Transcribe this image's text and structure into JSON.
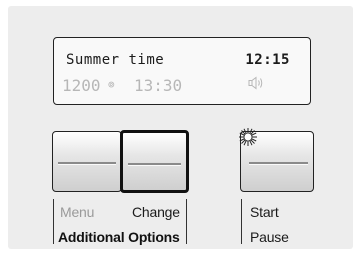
{
  "display": {
    "mode": "Summer time",
    "clock": "12:15",
    "spin_speed": "1200",
    "spin_symbol": "⊚",
    "duration": "13:30",
    "volume_icon": "speaker-icon"
  },
  "buttons": {
    "menu_label": "Menu",
    "change_label": "Change",
    "additional_label": "Additional Options",
    "start_label": "Start",
    "pause_label": "Pause",
    "start_indicator": "blinking"
  },
  "colors": {
    "panel": "#ededed",
    "active_text": "#1b1b1b",
    "inactive_text": "#9a9a9a",
    "highlight_border": "#111111"
  }
}
